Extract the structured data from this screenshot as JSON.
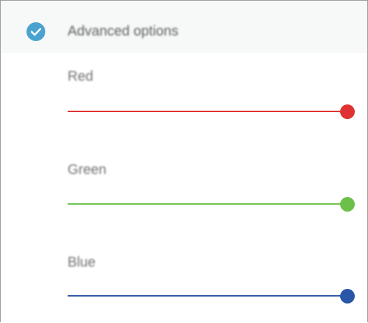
{
  "advanced": {
    "label": "Advanced options",
    "checked": true,
    "icon": "check-circle-icon",
    "accent_color": "#4aa3cf"
  },
  "sliders": [
    {
      "label": "Red",
      "value_fraction": 1.0,
      "color": "#e03232"
    },
    {
      "label": "Green",
      "value_fraction": 1.0,
      "color": "#6cc04a"
    },
    {
      "label": "Blue",
      "value_fraction": 1.0,
      "color": "#2a56a8"
    }
  ]
}
